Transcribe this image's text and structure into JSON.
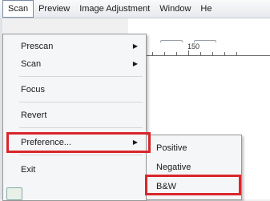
{
  "menubar": {
    "items": [
      "Scan",
      "Preview",
      "Image Adjustment",
      "Window",
      "He"
    ]
  },
  "toolbar": {
    "ruler_label": "150"
  },
  "scan_menu": {
    "items": [
      {
        "label": "Prescan",
        "has_submenu": true
      },
      {
        "label": "Scan",
        "has_submenu": true
      },
      {
        "label": "Focus",
        "has_submenu": false
      },
      {
        "label": "Revert",
        "has_submenu": false
      },
      {
        "label": "Preference...",
        "has_submenu": true,
        "highlighted": true
      },
      {
        "label": "Exit",
        "has_submenu": false
      }
    ]
  },
  "preference_submenu": {
    "items": [
      {
        "label": "Positive"
      },
      {
        "label": "Negative"
      },
      {
        "label": "B&W",
        "highlighted": true
      }
    ]
  },
  "colors": {
    "highlight_box": "#d9262c"
  }
}
